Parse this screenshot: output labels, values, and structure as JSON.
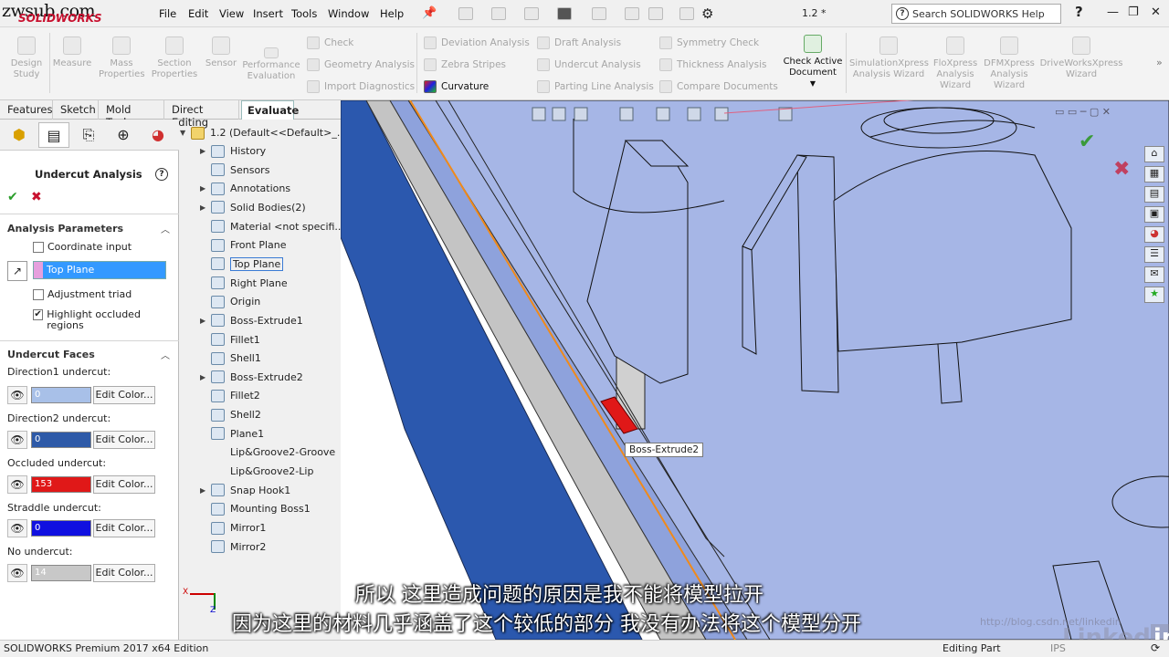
{
  "watermark": "zwsub.com",
  "logo_text": "SOLIDWORKS",
  "menu": [
    "File",
    "Edit",
    "View",
    "Insert",
    "Tools",
    "Window",
    "Help"
  ],
  "document_title": "1.2 *",
  "help_search_placeholder": "Search SOLIDWORKS Help",
  "ribbon": {
    "design_study": "Design Study",
    "measure": "Measure",
    "mass_properties": "Mass Properties",
    "section_properties": "Section Properties",
    "sensor": "Sensor",
    "performance_evaluation": "Performance Evaluation",
    "check": "Check",
    "geometry_analysis": "Geometry Analysis",
    "import_diagnostics": "Import Diagnostics",
    "deviation_analysis": "Deviation Analysis",
    "zebra_stripes": "Zebra Stripes",
    "curvature": "Curvature",
    "draft_analysis": "Draft Analysis",
    "undercut_analysis": "Undercut Analysis",
    "parting_line_analysis": "Parting Line Analysis",
    "symmetry_check": "Symmetry Check",
    "thickness_analysis": "Thickness Analysis",
    "compare_documents": "Compare Documents",
    "check_active_document": "Check Active Document",
    "simulationxpress": "SimulationXpress Analysis Wizard",
    "floxpress": "FloXpress Analysis Wizard",
    "dfmxpress": "DFMXpress Analysis Wizard",
    "driveworksxpress": "DriveWorksXpress Wizard"
  },
  "tabs": [
    "Features",
    "Sketch",
    "Mold Tools",
    "Direct Editing",
    "Evaluate"
  ],
  "active_tab": "Evaluate",
  "property_manager": {
    "title": "Undercut Analysis",
    "analysis_parameters": "Analysis Parameters",
    "coordinate_input": "Coordinate input",
    "direction_plane": "Top Plane",
    "adjustment_triad": "Adjustment triad",
    "highlight_occluded": "Highlight occluded regions",
    "undercut_faces": "Undercut Faces",
    "edit_color": "Edit Color...",
    "faces": [
      {
        "label": "Direction1 undercut:",
        "count": "0",
        "color": "#a8c0e8"
      },
      {
        "label": "Direction2 undercut:",
        "count": "0",
        "color": "#2e5aa8"
      },
      {
        "label": "Occluded undercut:",
        "count": "153",
        "color": "#e01818"
      },
      {
        "label": "Straddle undercut:",
        "count": "0",
        "color": "#1010e0"
      },
      {
        "label": "No undercut:",
        "count": "14",
        "color": "#c8c8c8"
      }
    ]
  },
  "tree": {
    "root": "1.2  (Default<<Default>_...",
    "items": [
      "History",
      "Sensors",
      "Annotations",
      "Solid Bodies(2)",
      "Material <not specifi...",
      "Front Plane",
      "Top Plane",
      "Right Plane",
      "Origin",
      "Boss-Extrude1",
      "Fillet1",
      "Shell1",
      "Boss-Extrude2",
      "Fillet2",
      "Shell2",
      "Plane1",
      "Lip&Groove2-Groove",
      "Lip&Groove2-Lip",
      "Snap Hook1",
      "Mounting Boss1",
      "Mirror1",
      "Mirror2"
    ]
  },
  "tooltip": "Boss-Extrude2",
  "status": {
    "edition": "SOLIDWORKS Premium 2017 x64 Edition",
    "mode": "Editing Part",
    "units": "IPS"
  },
  "subtitles": {
    "line1": "所以 这里造成问题的原因是我不能将模型拉开",
    "line2": "因为这里的材料几乎涵盖了这个较低的部分 我没有办法将这个模型分开"
  },
  "overlay_watermark": "http://blog.csdn.net/linkedin"
}
